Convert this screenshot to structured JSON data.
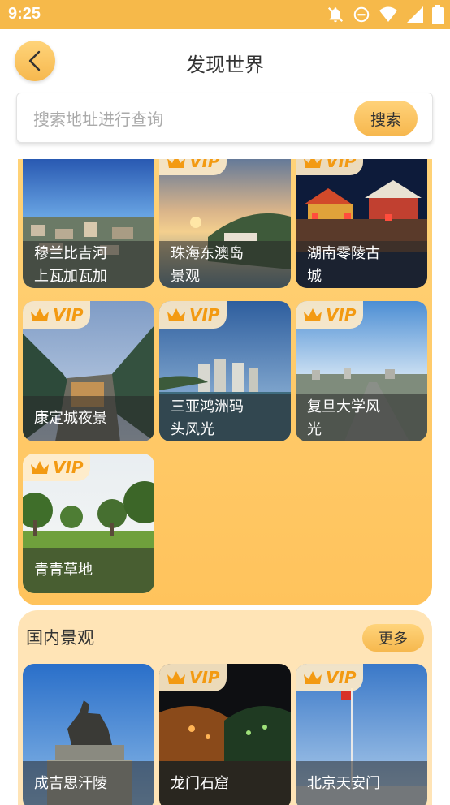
{
  "status": {
    "time": "9:25"
  },
  "header": {
    "title": "发现世界"
  },
  "search": {
    "placeholder": "搜索地址进行查询",
    "button": "搜索"
  },
  "vip_label": "VIP",
  "grid": [
    {
      "title": "穆兰比吉河上瓦加瓦加",
      "line1": "穆兰比吉河",
      "line2": "上瓦加瓦加",
      "vip": false
    },
    {
      "title": "珠海东澳岛景观",
      "line1": "珠海东澳岛",
      "line2": "景观",
      "vip": true
    },
    {
      "title": "湖南零陵古城",
      "line1": "湖南零陵古",
      "line2": "城",
      "vip": true
    },
    {
      "title": "康定城夜景",
      "line1": "康定城夜景",
      "line2": "",
      "vip": true
    },
    {
      "title": "三亚鸿洲码头风光",
      "line1": "三亚鸿洲码",
      "line2": "头风光",
      "vip": true
    },
    {
      "title": "复旦大学风光",
      "line1": "复旦大学风",
      "line2": "光",
      "vip": true
    },
    {
      "title": "青青草地",
      "line1": "青青草地",
      "line2": "",
      "vip": true
    }
  ],
  "domestic": {
    "title": "国内景观",
    "more": "更多",
    "items": [
      {
        "title": "成吉思汗陵",
        "vip": false
      },
      {
        "title": "龙门石窟",
        "vip": true
      },
      {
        "title": "北京天安门",
        "vip": true
      }
    ]
  },
  "colors": {
    "accent": "#f6b94a",
    "panel": "#ffc860",
    "vip_text": "#f39a12"
  }
}
